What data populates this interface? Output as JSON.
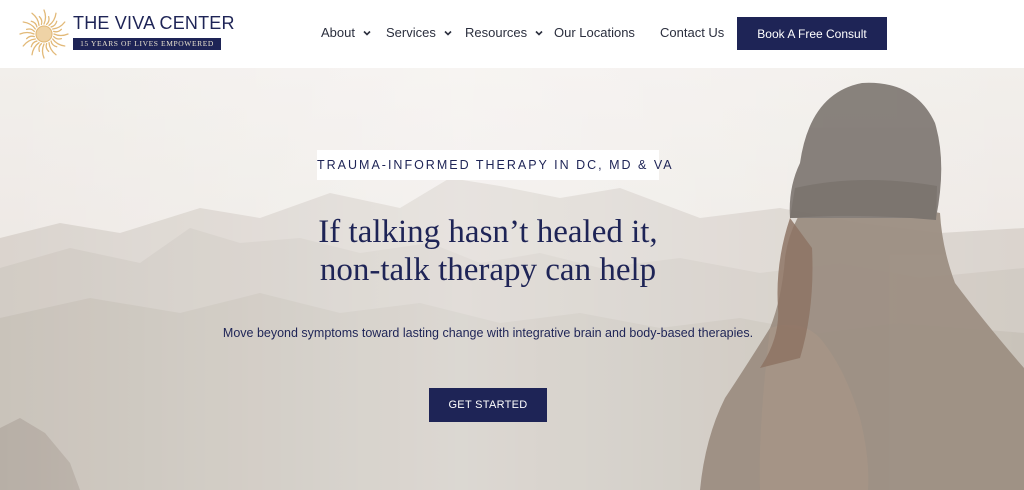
{
  "header": {
    "logo_name": "THE VIVA CENTER",
    "logo_tagline": "15 YEARS OF LIVES EMPOWERED",
    "nav": [
      {
        "label": "About",
        "has_dropdown": true
      },
      {
        "label": "Services",
        "has_dropdown": true
      },
      {
        "label": "Resources",
        "has_dropdown": true
      },
      {
        "label": "Our Locations",
        "has_dropdown": false
      },
      {
        "label": "Contact Us",
        "has_dropdown": false
      }
    ],
    "cta_label": "Book A Free Consult"
  },
  "hero": {
    "eyebrow": "TRAUMA-INFORMED THERAPY IN DC, MD & VA",
    "headline_line1": "If talking hasn’t healed it,",
    "headline_line2": "non-talk therapy can help",
    "subtext": "Move beyond symptoms toward lasting change with integrative brain and body-based therapies.",
    "cta_label": "GET STARTED"
  },
  "colors": {
    "navy": "#1e2456",
    "sun_gold": "#e2b978",
    "hero_haze": "#d9d2ca"
  },
  "icons": {
    "logo": "sun-icon",
    "dropdown": "chevron-down-icon"
  }
}
